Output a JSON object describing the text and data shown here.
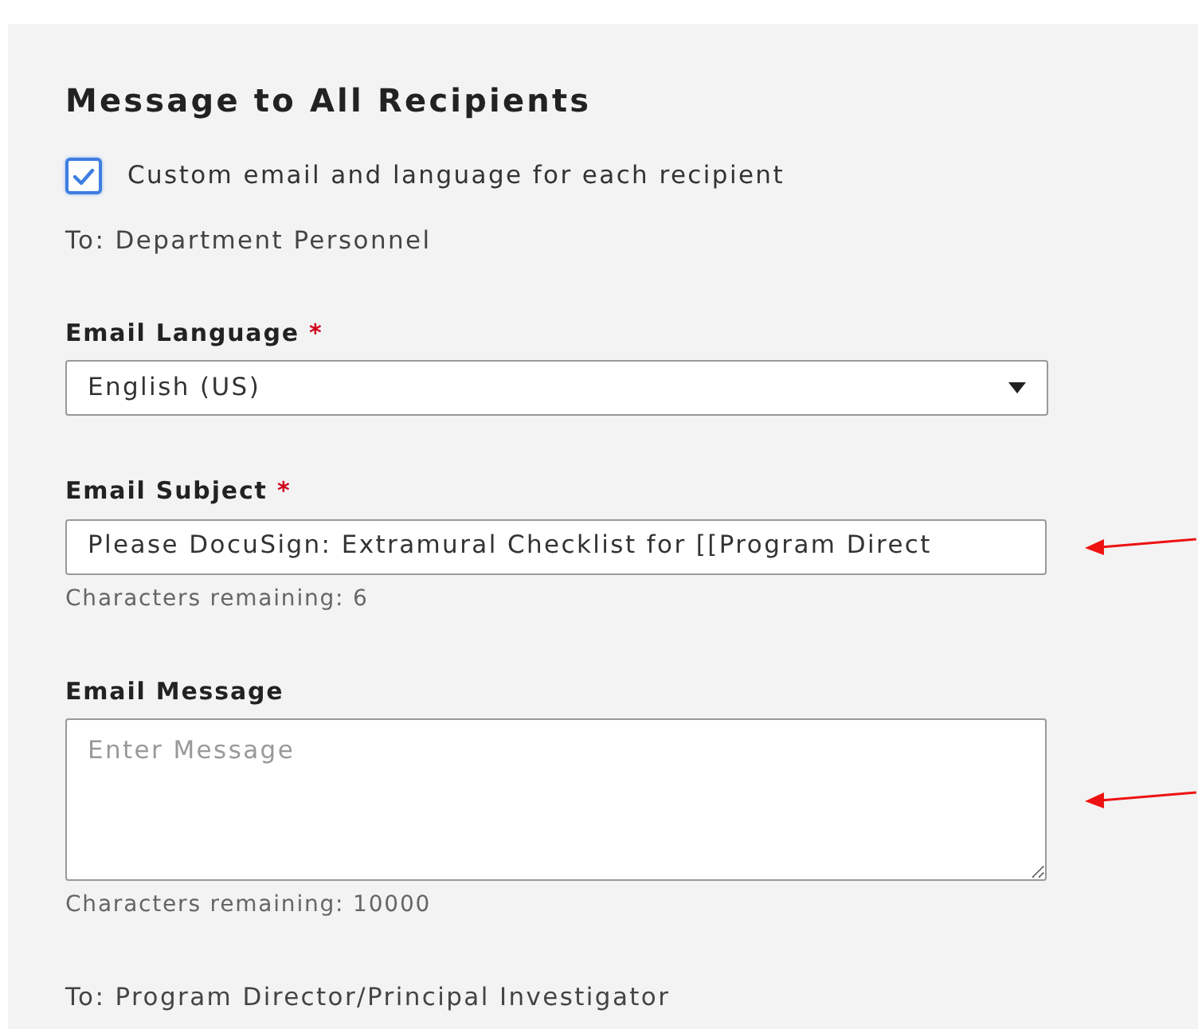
{
  "title": "Message to All Recipients",
  "custom_option": {
    "label": "Custom email and language for each recipient",
    "checked": true
  },
  "recipient_group_1": "To: Department Personnel",
  "fields": [
    {
      "kind": "select",
      "label": "Email Language",
      "required_mark": "*",
      "value": "English (US)"
    },
    {
      "kind": "text",
      "label": "Email Subject",
      "required_mark": "*",
      "value": "Please DocuSign: Extramural Checklist for [[Program Direct",
      "hint": "Characters remaining: 6",
      "arrow": true
    },
    {
      "kind": "textarea",
      "label": "Email Message",
      "placeholder": "Enter Message",
      "hint": "Characters remaining: 10000",
      "arrow": true
    }
  ],
  "recipient_group_2": "To: Program Director/Principal Investigator"
}
